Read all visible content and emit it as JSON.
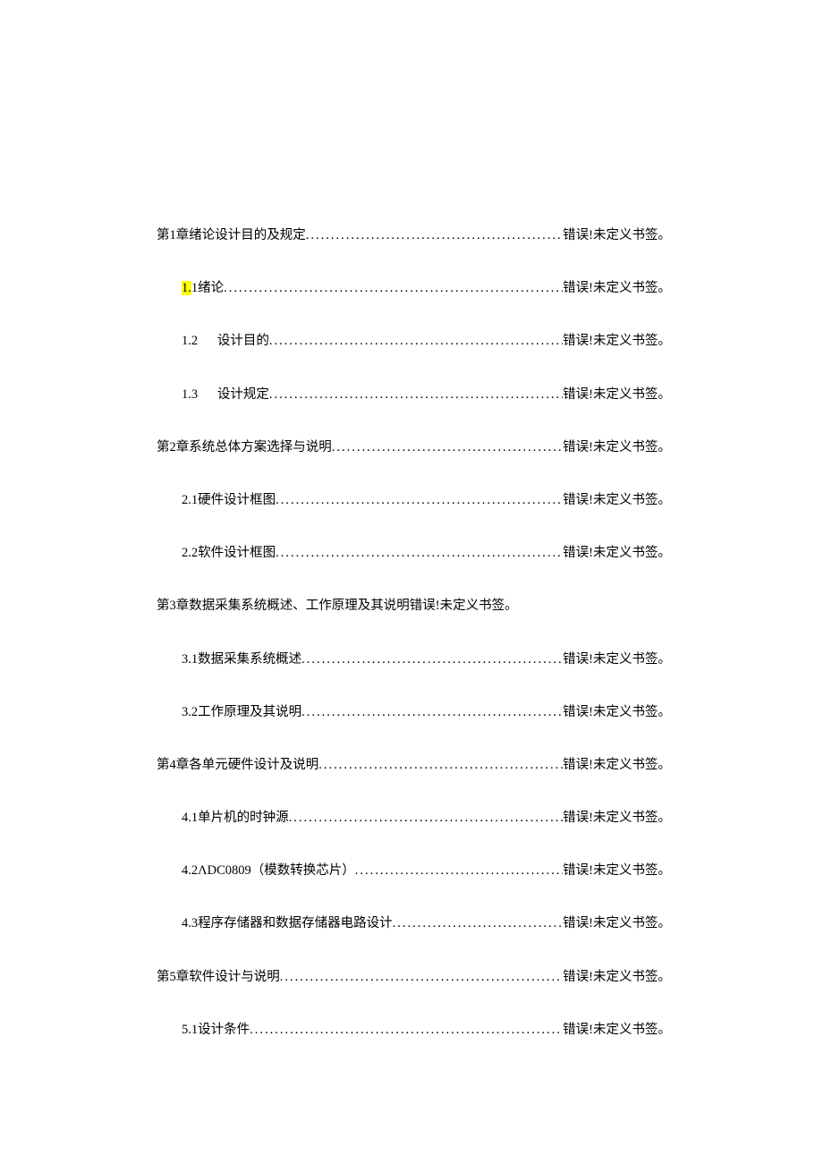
{
  "common": {
    "error_bookmark": "错误!未定义书签。"
  },
  "toc": [
    {
      "text": "第1章绪论设计目的及规定",
      "level": 1
    },
    {
      "text_pre_hl": "",
      "hl": "1.",
      "text_post_hl": "1绪论",
      "level": 2,
      "highlight": true
    },
    {
      "text": "1.2 设计目的",
      "level": 2,
      "wide_gap": true
    },
    {
      "text": "1.3 设计规定",
      "level": 2,
      "wide_gap": true
    },
    {
      "text": "第2章系统总体方案选择与说明",
      "level": 1
    },
    {
      "text": "2.1硬件设计框图",
      "level": 2
    },
    {
      "text": "2.2软件设计框图",
      "level": 2
    },
    {
      "text": "第3章数据采集系统概述、工作原理及其说明错误!未定义书签。",
      "level": 1,
      "no_leader": true,
      "no_page": true
    },
    {
      "text": "3.1数据采集系统概述",
      "level": 2
    },
    {
      "text": "3.2工作原理及其说明",
      "level": 2
    },
    {
      "text": "第4章各单元硬件设计及说明",
      "level": 1
    },
    {
      "text": "4.1单片机的时钟源",
      "level": 2
    },
    {
      "text": "4.2ΛDC0809（模数转换芯片）",
      "level": 2
    },
    {
      "text": "4.3程序存储器和数据存储器电路设计",
      "level": 2
    },
    {
      "text": "第5章软件设计与说明",
      "level": 1
    },
    {
      "text": "5.1设计条件",
      "level": 2
    }
  ]
}
